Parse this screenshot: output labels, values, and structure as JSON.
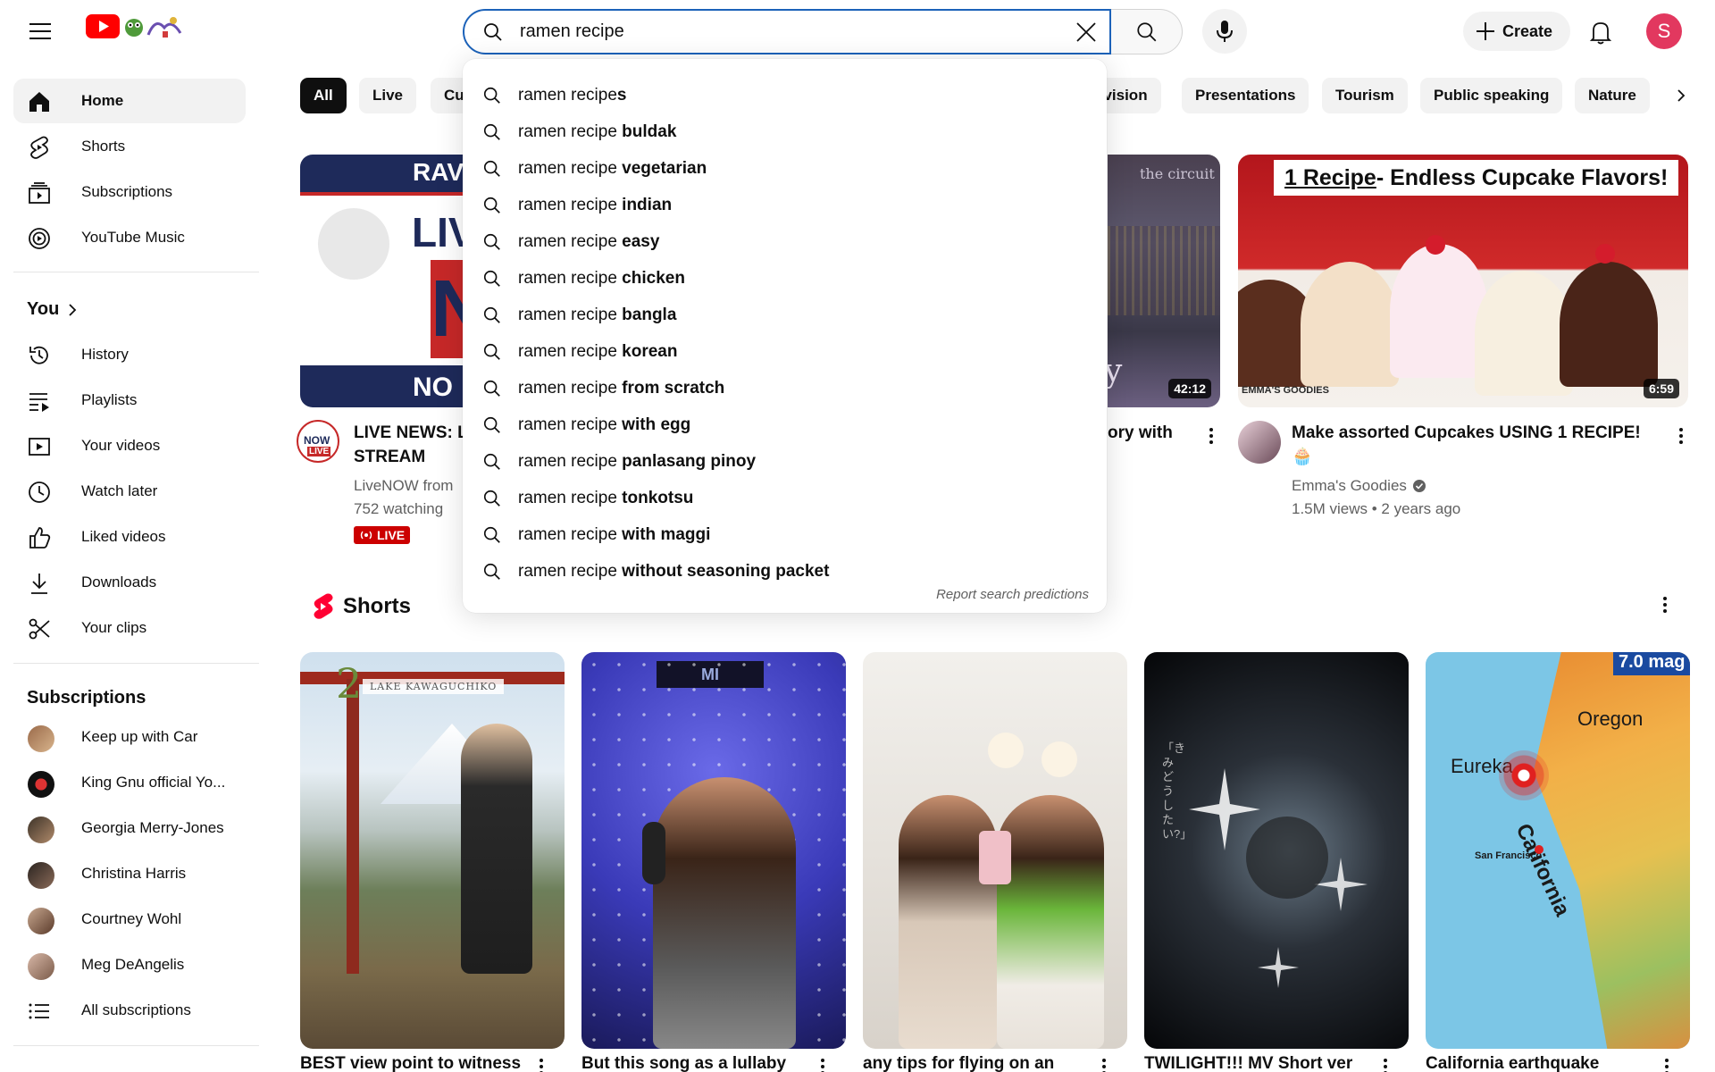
{
  "header": {
    "search_value": "ramen recipe",
    "create_label": "Create",
    "avatar_letter": "S",
    "brand_color": "#ff0000",
    "accent_color": "#1c62b9"
  },
  "sidebar": {
    "main": [
      {
        "label": "Home",
        "icon": "home-icon"
      },
      {
        "label": "Shorts",
        "icon": "shorts-icon"
      },
      {
        "label": "Subscriptions",
        "icon": "subscriptions-icon"
      },
      {
        "label": "YouTube Music",
        "icon": "youtube-music-icon"
      }
    ],
    "you_heading": "You",
    "you": [
      {
        "label": "History",
        "icon": "history-icon"
      },
      {
        "label": "Playlists",
        "icon": "playlists-icon"
      },
      {
        "label": "Your videos",
        "icon": "your-videos-icon"
      },
      {
        "label": "Watch later",
        "icon": "watch-later-icon"
      },
      {
        "label": "Liked videos",
        "icon": "liked-icon"
      },
      {
        "label": "Downloads",
        "icon": "download-icon"
      },
      {
        "label": "Your clips",
        "icon": "scissors-icon"
      }
    ],
    "subscriptions_heading": "Subscriptions",
    "subscriptions": [
      {
        "label": "Keep up with Car"
      },
      {
        "label": "King Gnu official Yo..."
      },
      {
        "label": "Georgia Merry-Jones"
      },
      {
        "label": "Christina Harris"
      },
      {
        "label": "Courtney Wohl"
      },
      {
        "label": "Meg DeAngelis"
      },
      {
        "label": "All subscriptions"
      }
    ]
  },
  "chips": [
    "All",
    "Live",
    "Cu",
    "evision",
    "Presentations",
    "Tourism",
    "Public speaking",
    "Nature"
  ],
  "suggestions": [
    {
      "prefix": "ramen recipe",
      "suffix": "s"
    },
    {
      "prefix": "ramen recipe",
      "suffix": " buldak"
    },
    {
      "prefix": "ramen recipe",
      "suffix": " vegetarian"
    },
    {
      "prefix": "ramen recipe",
      "suffix": " indian"
    },
    {
      "prefix": "ramen recipe",
      "suffix": " easy"
    },
    {
      "prefix": "ramen recipe",
      "suffix": " chicken"
    },
    {
      "prefix": "ramen recipe",
      "suffix": " bangla"
    },
    {
      "prefix": "ramen recipe",
      "suffix": " korean"
    },
    {
      "prefix": "ramen recipe",
      "suffix": " from scratch"
    },
    {
      "prefix": "ramen recipe",
      "suffix": " with egg"
    },
    {
      "prefix": "ramen recipe",
      "suffix": " panlasang pinoy"
    },
    {
      "prefix": "ramen recipe",
      "suffix": " tonkotsu"
    },
    {
      "prefix": "ramen recipe",
      "suffix": " with maggi"
    },
    {
      "prefix": "ramen recipe",
      "suffix": " without seasoning packet"
    }
  ],
  "report_label": "Report search predictions",
  "videos": {
    "v1": {
      "thumb_text_1": "RAV",
      "thumb_text_2": "LIV",
      "thumb_text_3": "N",
      "thumb_text_4": "NO",
      "channel_badge_1": "NOW",
      "channel_badge_2": "LIVE",
      "title_line1": "LIVE NEWS: L",
      "title_line2": "STREAM",
      "channel": "LiveNOW from",
      "meta": "752 watching",
      "live_label": "LIVE"
    },
    "v2": {
      "thumb_text": "the circuit",
      "thumb_letter": "y",
      "duration": "42:12",
      "title_fragment": "ory with"
    },
    "v3": {
      "thumb_banner_link": "1 Recipe",
      "thumb_banner_rest": " - Endless Cupcake Flavors!",
      "thumb_brand": "EMMA'S GOODIES",
      "duration": "6:59",
      "title": "Make assorted Cupcakes USING 1 RECIPE!",
      "emoji": "🧁",
      "channel": "Emma's Goodies",
      "meta": "1.5M views • 2 years ago"
    }
  },
  "shorts": {
    "heading": "Shorts",
    "items": [
      {
        "title": "BEST view point to witness",
        "overlay": "LAKE KAWAGUCHIKO",
        "overlay_num": "2"
      },
      {
        "title": "But this song as a lullaby",
        "overlay": "MI"
      },
      {
        "title": "any tips for flying on an",
        "overlay": ""
      },
      {
        "title": "TWILIGHT!!! MV Short ver",
        "overlay": "「きみどうしたい?」"
      },
      {
        "title": "California earthquake",
        "overlay": "7.0 mag",
        "map_labels": [
          "Oregon",
          "Eureka",
          "California",
          "San Francisco"
        ]
      }
    ]
  }
}
